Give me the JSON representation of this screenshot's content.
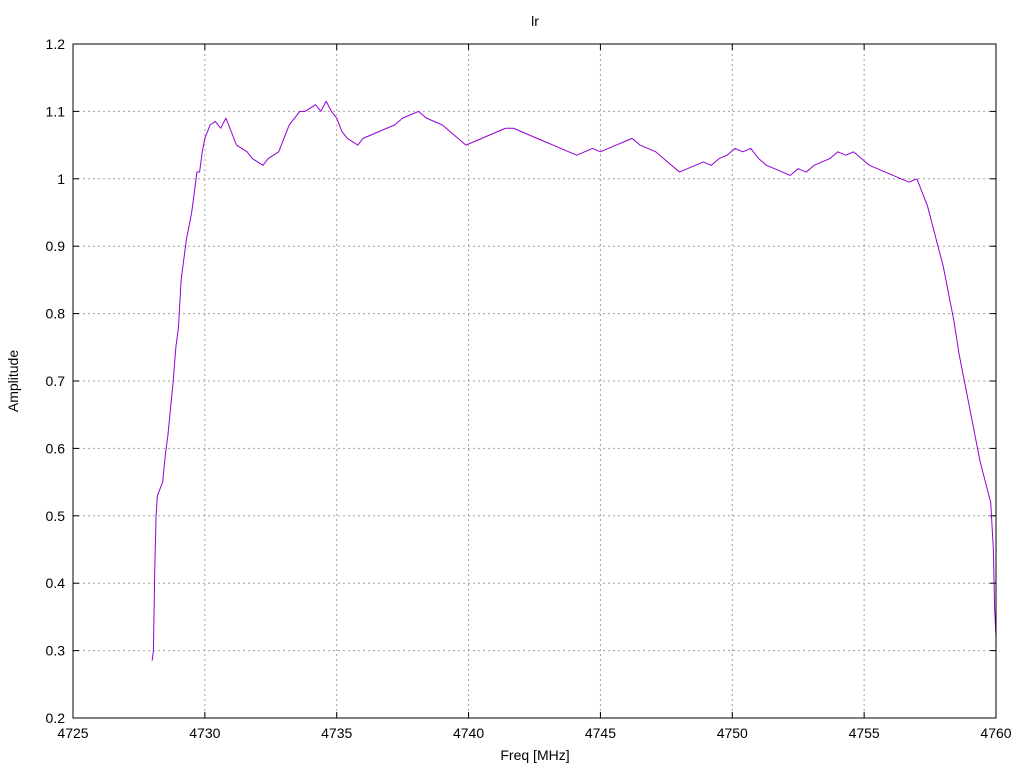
{
  "chart_data": {
    "type": "line",
    "title": "lr",
    "xlabel": "Freq [MHz]",
    "ylabel": "Amplitude",
    "xlim": [
      4725,
      4760
    ],
    "ylim": [
      0.2,
      1.2
    ],
    "grid": true,
    "x_ticks": [
      "4725",
      "4730",
      "4735",
      "4740",
      "4745",
      "4750",
      "4755",
      "4760"
    ],
    "y_ticks": [
      "0.2",
      "0.3",
      "0.4",
      "0.5",
      "0.6",
      "0.7",
      "0.8",
      "0.9",
      "1",
      "1.1",
      "1.2"
    ],
    "series": [
      {
        "color": "#9400d3",
        "x": [
          4728.0,
          4728.05,
          4728.1,
          4728.15,
          4728.2,
          4728.3,
          4728.4,
          4728.5,
          4728.6,
          4728.7,
          4728.8,
          4728.9,
          4729.0,
          4729.1,
          4729.2,
          4729.3,
          4729.4,
          4729.5,
          4729.6,
          4729.7,
          4729.8,
          4729.9,
          4730.0,
          4730.2,
          4730.4,
          4730.6,
          4730.8,
          4731.0,
          4731.2,
          4731.4,
          4731.6,
          4731.8,
          4732.0,
          4732.2,
          4732.4,
          4732.6,
          4732.8,
          4733.0,
          4733.2,
          4733.4,
          4733.6,
          4733.8,
          4734.0,
          4734.2,
          4734.4,
          4734.6,
          4734.8,
          4735.0,
          4735.2,
          4735.4,
          4735.6,
          4735.8,
          4736.0,
          4736.3,
          4736.6,
          4736.9,
          4737.2,
          4737.5,
          4737.8,
          4738.1,
          4738.4,
          4738.7,
          4739.0,
          4739.3,
          4739.6,
          4739.9,
          4740.2,
          4740.5,
          4740.8,
          4741.1,
          4741.4,
          4741.7,
          4742.0,
          4742.3,
          4742.6,
          4742.9,
          4743.2,
          4743.5,
          4743.8,
          4744.1,
          4744.4,
          4744.7,
          4745.0,
          4745.3,
          4745.6,
          4745.9,
          4746.2,
          4746.5,
          4746.8,
          4747.1,
          4747.4,
          4747.7,
          4748.0,
          4748.3,
          4748.6,
          4748.9,
          4749.2,
          4749.5,
          4749.8,
          4750.1,
          4750.4,
          4750.7,
          4751.0,
          4751.3,
          4751.6,
          4751.9,
          4752.2,
          4752.5,
          4752.8,
          4753.1,
          4753.4,
          4753.7,
          4754.0,
          4754.3,
          4754.6,
          4754.9,
          4755.2,
          4755.5,
          4755.8,
          4756.1,
          4756.4,
          4756.7,
          4757.0,
          4757.2,
          4757.4,
          4757.6,
          4757.8,
          4758.0,
          4758.2,
          4758.4,
          4758.6,
          4758.8,
          4759.0,
          4759.2,
          4759.4,
          4759.6,
          4759.8,
          4759.9,
          4759.95,
          4760.0
        ],
        "y": [
          0.285,
          0.3,
          0.42,
          0.5,
          0.53,
          0.54,
          0.55,
          0.59,
          0.62,
          0.66,
          0.7,
          0.75,
          0.78,
          0.85,
          0.88,
          0.91,
          0.93,
          0.95,
          0.98,
          1.01,
          1.01,
          1.04,
          1.06,
          1.08,
          1.085,
          1.075,
          1.09,
          1.07,
          1.05,
          1.045,
          1.04,
          1.03,
          1.025,
          1.02,
          1.03,
          1.035,
          1.04,
          1.06,
          1.08,
          1.09,
          1.1,
          1.1,
          1.105,
          1.11,
          1.1,
          1.115,
          1.1,
          1.09,
          1.07,
          1.06,
          1.055,
          1.05,
          1.06,
          1.065,
          1.07,
          1.075,
          1.08,
          1.09,
          1.095,
          1.1,
          1.09,
          1.085,
          1.08,
          1.07,
          1.06,
          1.05,
          1.055,
          1.06,
          1.065,
          1.07,
          1.075,
          1.075,
          1.07,
          1.065,
          1.06,
          1.055,
          1.05,
          1.045,
          1.04,
          1.035,
          1.04,
          1.045,
          1.04,
          1.045,
          1.05,
          1.055,
          1.06,
          1.05,
          1.045,
          1.04,
          1.03,
          1.02,
          1.01,
          1.015,
          1.02,
          1.025,
          1.02,
          1.03,
          1.035,
          1.045,
          1.04,
          1.045,
          1.03,
          1.02,
          1.015,
          1.01,
          1.005,
          1.015,
          1.01,
          1.02,
          1.025,
          1.03,
          1.04,
          1.035,
          1.04,
          1.03,
          1.02,
          1.015,
          1.01,
          1.005,
          1.0,
          0.995,
          1.0,
          0.98,
          0.96,
          0.93,
          0.9,
          0.87,
          0.83,
          0.79,
          0.74,
          0.7,
          0.66,
          0.62,
          0.58,
          0.55,
          0.52,
          0.45,
          0.36,
          0.32
        ]
      }
    ]
  }
}
